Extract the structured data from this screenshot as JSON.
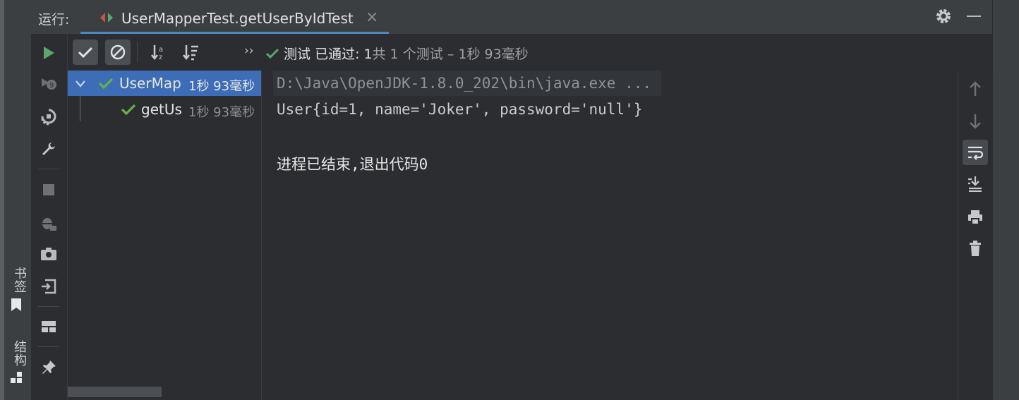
{
  "sidebar_left": {
    "bookmarks_label": "书签",
    "structure_label": "结构",
    "bookmark_icon": "bookmark-icon",
    "structure_icon": "structure-icon"
  },
  "header": {
    "run_label": "运行:",
    "tab_title": "UserMapperTest.getUserByIdTest",
    "tab_close": "×"
  },
  "toolbar": {
    "status_prefix": "测试 已通过: 1",
    "status_suffix": "共 1 个测试 – 1秒 93毫秒",
    "chevron": "››"
  },
  "tree": {
    "items": [
      {
        "label": "UserMap",
        "time": "1秒 93毫秒"
      },
      {
        "label": "getUs",
        "time": "1秒 93毫秒"
      }
    ]
  },
  "console": {
    "lines": [
      "D:\\Java\\OpenJDK-1.8.0_202\\bin\\java.exe ...",
      "User{id=1, name='Joker', password='null'}",
      "",
      "进程已结束,退出代码0"
    ]
  },
  "colors": {
    "pass_green": "#59a869",
    "accent_blue": "#4a88c7",
    "selection": "#3d6db6"
  }
}
